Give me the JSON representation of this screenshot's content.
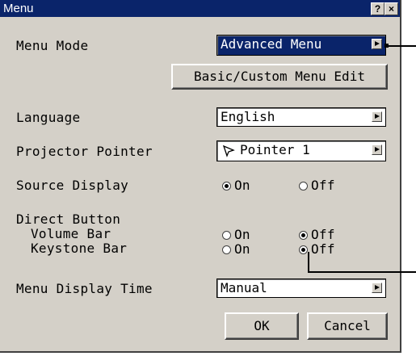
{
  "window": {
    "title": "Menu",
    "help_label": "?",
    "close_label": "×"
  },
  "menu_mode": {
    "label": "Menu Mode",
    "value": "Advanced Menu"
  },
  "basic_custom_button": "Basic/Custom Menu Edit",
  "language": {
    "label": "Language",
    "value": "English"
  },
  "projector_pointer": {
    "label": "Projector Pointer",
    "value": "Pointer 1"
  },
  "source_display": {
    "label": "Source Display",
    "on_label": "On",
    "off_label": "Off",
    "selected": "On"
  },
  "direct_button": {
    "label": "Direct Button",
    "volume_bar": {
      "label": "Volume Bar",
      "on_label": "On",
      "off_label": "Off",
      "selected": "Off"
    },
    "keystone_bar": {
      "label": "Keystone Bar",
      "on_label": "On",
      "off_label": "Off",
      "selected": "Off"
    }
  },
  "menu_display_time": {
    "label": "Menu Display Time",
    "value": "Manual"
  },
  "buttons": {
    "ok": "OK",
    "cancel": "Cancel"
  },
  "colors": {
    "title_bar": "#0a246a",
    "dialog_face": "#d4d0c8",
    "selected_field": "#0a246a"
  }
}
